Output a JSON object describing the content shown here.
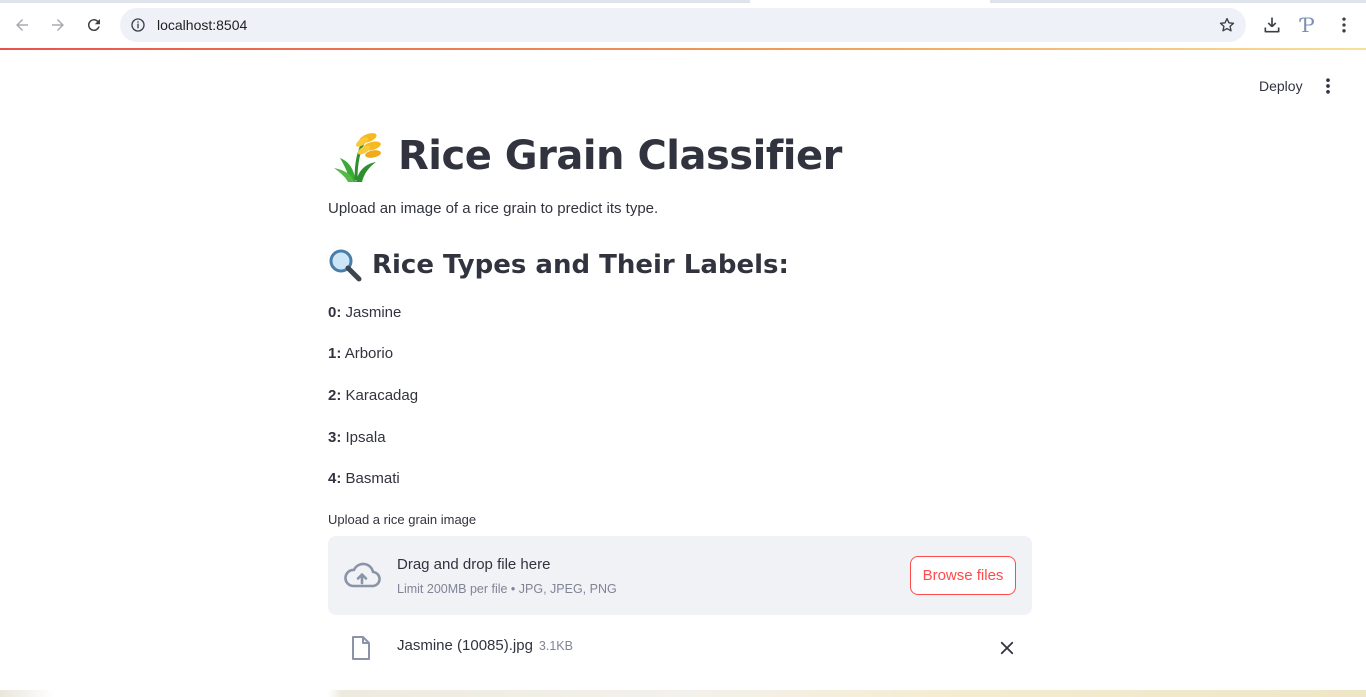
{
  "browser": {
    "url": "localhost:8504"
  },
  "header": {
    "deploy_label": "Deploy"
  },
  "main": {
    "title": "Rice Grain Classifier",
    "subtitle": "Upload an image of a rice grain to predict its type.",
    "labels_heading": "Rice Types and Their Labels:",
    "labels": [
      {
        "key": "0:",
        "name": "Jasmine"
      },
      {
        "key": "1:",
        "name": "Arborio"
      },
      {
        "key": "2:",
        "name": "Karacadag"
      },
      {
        "key": "3:",
        "name": "Ipsala"
      },
      {
        "key": "4:",
        "name": "Basmati"
      }
    ]
  },
  "uploader": {
    "label": "Upload a rice grain image",
    "drop_title": "Drag and drop file here",
    "drop_sub": "Limit 200MB per file • JPG, JPEG, PNG",
    "browse_label": "Browse files",
    "file_name": "Jasmine (10085).jpg",
    "file_size": "3.1KB"
  },
  "colors": {
    "accent": "#ff4b4b",
    "text": "#31333f",
    "muted": "#808495",
    "dropzone_bg": "#f0f2f6"
  },
  "icons": [
    "back-arrow-icon",
    "forward-arrow-icon",
    "reload-icon",
    "site-info-icon",
    "bookmark-star-icon",
    "download-icon",
    "profile-p-icon",
    "chrome-menu-icon",
    "kebab-menu-icon",
    "rice-plant-icon",
    "magnifying-glass-icon",
    "cloud-upload-icon",
    "file-icon",
    "close-icon"
  ]
}
